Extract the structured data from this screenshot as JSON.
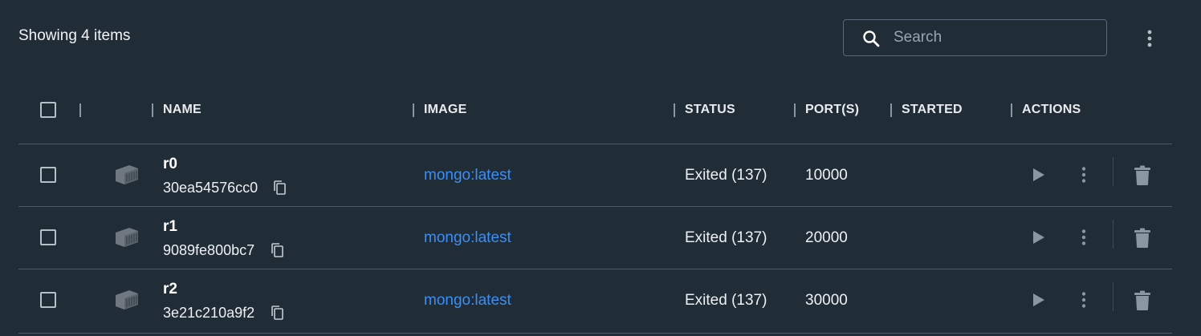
{
  "toolbar": {
    "showing_text": "Showing 4 items",
    "search_placeholder": "Search"
  },
  "table": {
    "columns": [
      "NAME",
      "IMAGE",
      "STATUS",
      "PORT(S)",
      "STARTED",
      "ACTIONS"
    ],
    "rows": [
      {
        "name": "r0",
        "id": "30ea54576cc0",
        "image": "mongo:latest",
        "status": "Exited (137)",
        "port": "10000",
        "started": ""
      },
      {
        "name": "r1",
        "id": "9089fe800bc7",
        "image": "mongo:latest",
        "status": "Exited (137)",
        "port": "20000",
        "started": ""
      },
      {
        "name": "r2",
        "id": "3e21c210a9f2",
        "image": "mongo:latest",
        "status": "Exited (137)",
        "port": "30000",
        "started": ""
      }
    ]
  },
  "icons": {
    "search": "search-icon",
    "more": "more-vertical-icon",
    "container": "container-icon",
    "copy": "copy-icon",
    "play": "play-icon",
    "delete": "trash-icon"
  },
  "colors": {
    "background": "#202c36",
    "link": "#3b8ff6",
    "icon": "#8a97a1"
  }
}
